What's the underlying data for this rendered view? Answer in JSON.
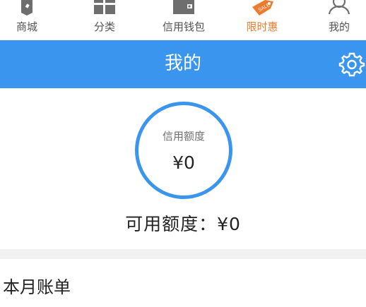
{
  "tabs": [
    {
      "label": "商城",
      "icon": "tag-icon",
      "active": false
    },
    {
      "label": "分类",
      "icon": "grid-icon",
      "active": false
    },
    {
      "label": "信用钱包",
      "icon": "wallet-icon",
      "active": false
    },
    {
      "label": "限时惠",
      "icon": "sale-tag-icon",
      "active": true
    },
    {
      "label": "我的",
      "icon": "person-icon",
      "active": false
    }
  ],
  "header": {
    "title": "我的",
    "settings_icon": "gear-icon"
  },
  "credit": {
    "label": "信用额度",
    "value": "¥0"
  },
  "available": {
    "text": "可用额度：¥0"
  },
  "bill": {
    "title": "本月账单"
  },
  "colors": {
    "accent_blue": "#3a95ee",
    "active_tab_orange": "#ee7a2b",
    "tab_gray": "#555555"
  }
}
